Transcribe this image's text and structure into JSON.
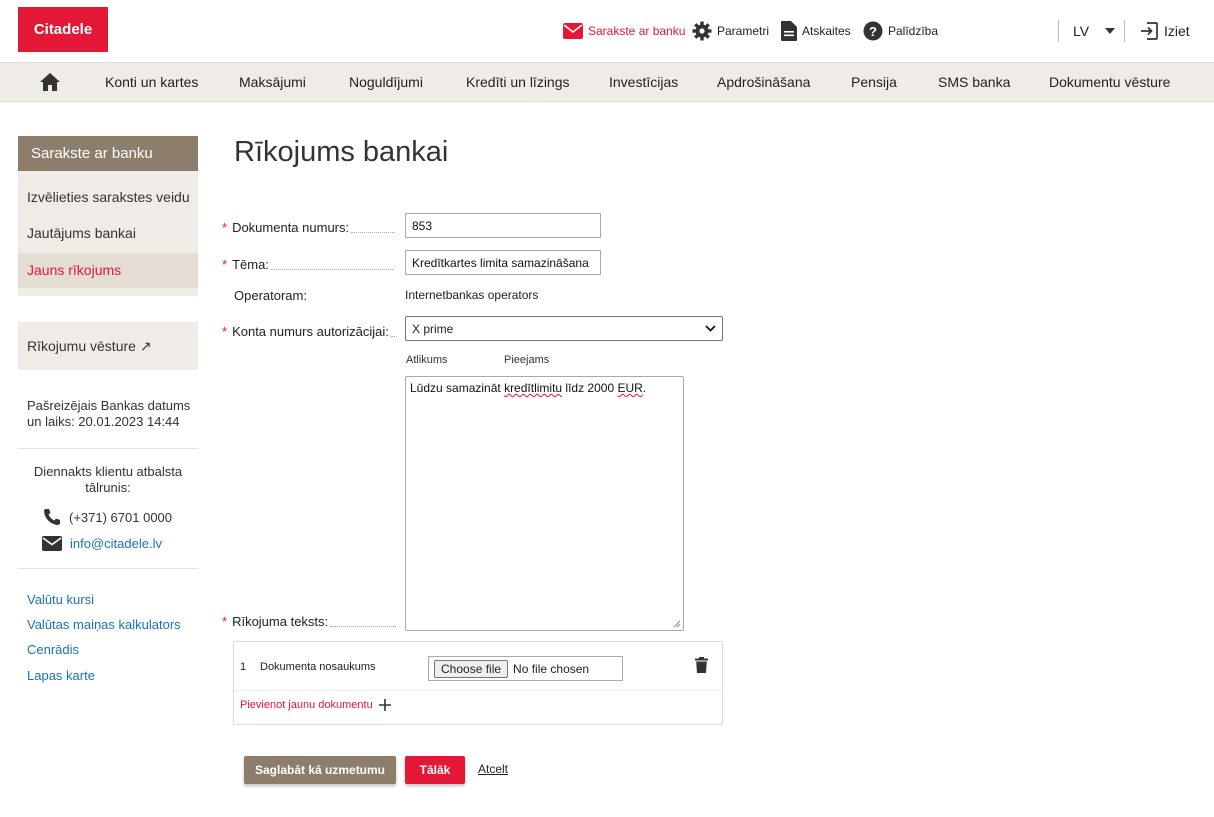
{
  "header": {
    "logo": "Citadele",
    "links": {
      "messages": "Sarakste ar banku",
      "settings": "Parametri",
      "reports": "Atskaites",
      "help": "Palīdzība"
    },
    "language": "LV",
    "exit": "Iziet"
  },
  "nav": {
    "items": [
      "Konti un kartes",
      "Maksājumi",
      "Noguldījumi",
      "Kredīti un līzings",
      "Investīcijas",
      "Apdrošināšana",
      "Pensija",
      "SMS banka",
      "Dokumentu vēsture"
    ]
  },
  "sidebar": {
    "heading": "Sarakste ar banku",
    "items": [
      "Izvēlieties sarakstes veidu",
      "Jautājums bankai",
      "Jauns rīkojums"
    ],
    "active_index": 2,
    "history": "Rīkojumu vēsture ↗",
    "date_line1": "Pašreizējais Bankas datums",
    "date_line2": "un laiks: 20.01.2023 14:44",
    "support_line1": "Diennakts klientu atbalsta",
    "support_line2": "tālrunis:",
    "phone": "(+371) 6701 0000",
    "email": "info@citadele.lv",
    "links": [
      "Valūtu kursi",
      "Valūtas maiņas kalkulators",
      "Cenrādis",
      "Lapas karte"
    ]
  },
  "main": {
    "title": "Rīkojums bankai",
    "doc_number_label": "Dokumenta numurs:",
    "doc_number_value": "853",
    "topic_label": "Tēma:",
    "topic_value": "Kredītkartes limita samazināšana",
    "operator_label": "Operatoram:",
    "operator_value": "Internetbankas operators",
    "account_label": "Konta numurs autorizācijai:",
    "account_value": "X prime",
    "balance_label": "Atlikums",
    "available_label": "Pieejams",
    "text_label": "Rīkojuma teksts:",
    "text_part1": "Lūdzu samazināt ",
    "text_part2": "kredītlimitu",
    "text_part3": " līdz 2000 ",
    "text_part4": "EUR",
    "text_part5": ".",
    "doc_row_number": "1",
    "doc_name_label": "Dokumenta nosaukums",
    "file_button": "Choose file",
    "file_status": "No file chosen",
    "add_document": "Pievienot jaunu dokumentu",
    "save_draft": "Saglabāt kā uzmetumu",
    "next": "Tālāk",
    "cancel": "Atcelt"
  },
  "colors": {
    "brand_red": "#e31837",
    "nav_bg": "#efece7",
    "sidebar_head": "#8c7e6a",
    "draft_button": "#8c7e6a",
    "link_blue": "#1a73b8"
  }
}
